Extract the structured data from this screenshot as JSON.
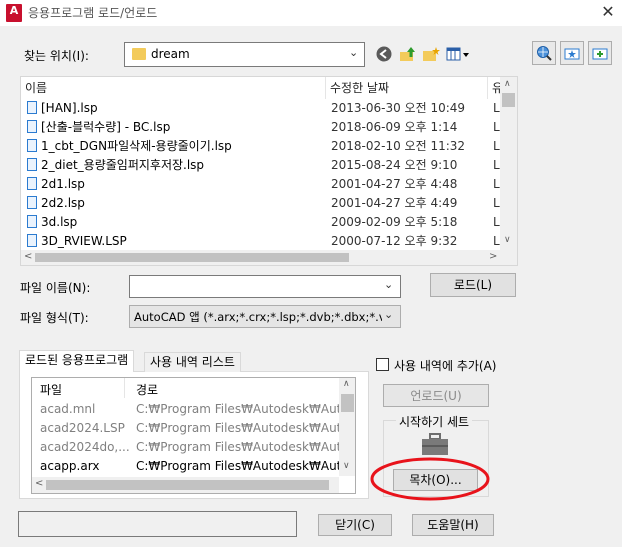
{
  "window": {
    "title": "응용프로그램 로드/언로드",
    "close_glyph": "✕",
    "app_icon_letter": "A"
  },
  "location": {
    "label": "찾는 위치(I):",
    "folder": "dream",
    "icons": [
      "back-icon",
      "up-folder-icon",
      "new-folder-icon",
      "views-menu-icon"
    ],
    "side_icons": [
      "search-web-icon",
      "folder-star-icon",
      "folder-add-icon"
    ]
  },
  "filelist": {
    "columns": {
      "name": "이름",
      "modified": "수정한 날짜",
      "type_partial": "유"
    },
    "rows": [
      {
        "name": "[HAN].lsp",
        "date": "2013-06-30 오전 10:49",
        "type": "LS"
      },
      {
        "name": "[산출-블럭수량] - BC.lsp",
        "date": "2018-06-09 오후 1:14",
        "type": "LS"
      },
      {
        "name": "1_cbt_DGN파일삭제-용량줄이기.lsp",
        "date": "2018-02-10 오전 11:32",
        "type": "LS"
      },
      {
        "name": "2_diet_용량줄임퍼지후저장.lsp",
        "date": "2015-08-24 오전 9:10",
        "type": "LS"
      },
      {
        "name": "2d1.lsp",
        "date": "2001-04-27 오후 4:48",
        "type": "LS"
      },
      {
        "name": "2d2.lsp",
        "date": "2001-04-27 오후 4:49",
        "type": "LS"
      },
      {
        "name": "3d.lsp",
        "date": "2009-02-09 오후 5:18",
        "type": "LS"
      },
      {
        "name": "3D_RVIEW.LSP",
        "date": "2000-07-12 오후 9:32",
        "type": "LS"
      }
    ]
  },
  "filename": {
    "label": "파일 이름(N):",
    "value": ""
  },
  "filetype": {
    "label": "파일 형식(T):",
    "value": "AutoCAD 앱 (*.arx;*.crx;*.lsp;*.dvb;*.dbx;*.vlx;*"
  },
  "buttons": {
    "load": "로드(L)",
    "unload": "언로드(U)",
    "contents": "목차(O)...",
    "close": "닫기(C)",
    "help": "도움말(H)"
  },
  "tabs": {
    "loaded": "로드된 응용프로그램",
    "history": "사용 내역 리스트"
  },
  "history_checkbox": {
    "label": "사용 내역에 추가(A)",
    "checked": false
  },
  "loaded": {
    "columns": {
      "file": "파일",
      "path": "경로"
    },
    "rows": [
      {
        "file": "acad.mnl",
        "path": "C:₩Program Files₩Autodesk₩Aut..",
        "dim": true
      },
      {
        "file": "acad2024.LSP",
        "path": "C:₩Program Files₩Autodesk₩Aut..",
        "dim": true
      },
      {
        "file": "acad2024do,...",
        "path": "C:₩Program Files₩Autodesk₩Aut..",
        "dim": true
      },
      {
        "file": "acapp.arx",
        "path": "C:₩Program Files₩Autodesk₩Aut..",
        "dim": false
      }
    ]
  },
  "startup": {
    "label": "시작하기 세트",
    "icon": "briefcase-icon"
  },
  "status": {
    "value": ""
  },
  "colors": {
    "annotation": "#e8131b",
    "folder": "#f3cb5b",
    "doc_icon": "#2b7bd0"
  }
}
